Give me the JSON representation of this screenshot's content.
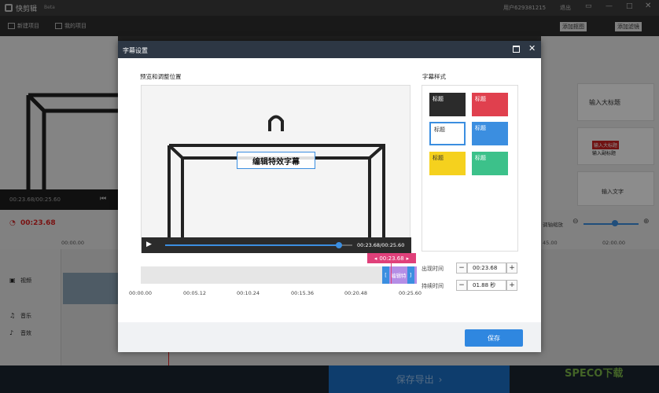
{
  "app": {
    "name": "快剪辑",
    "badge": "Beta",
    "user": "用户629381215",
    "logout": "退出"
  },
  "toolbar": {
    "new_project": "新建项目",
    "my_projects": "我的项目",
    "right_label_1": "添加抠图",
    "right_label_2": "添加滤镜"
  },
  "player": {
    "time": "00:23.68/00:25.60"
  },
  "timeline": {
    "current": "00:23.68",
    "start": "00:00.00",
    "ticks_right": [
      "45.00",
      "02:00.00"
    ],
    "zoom_label": "调轴缩放"
  },
  "tracks": {
    "video": "视频",
    "music": "音乐",
    "sound": "音效"
  },
  "right_panel": {
    "card1": "输入大标题",
    "card2a": "输入大标题",
    "card2b": "输入副标题",
    "card3": "输入文字"
  },
  "export": {
    "label": "保存导出"
  },
  "watermark": {
    "text": "SPECO下载"
  },
  "dialog": {
    "title": "字幕设置",
    "preview_label": "预览和调整位置",
    "subtitle_text": "编辑特效字幕",
    "player_time": "00:23.68/00:25.60",
    "progress": 0.93,
    "style_label": "字幕样式",
    "styles": [
      {
        "label": "标题",
        "bg": "#2b2b2b",
        "fg": "#ffffff"
      },
      {
        "label": "标题",
        "bg": "#e0404e",
        "fg": "#ffffff"
      },
      {
        "label": "标题",
        "bg": "#ffffff",
        "fg": "#333333"
      },
      {
        "label": "标题",
        "bg": "#3b8ee0",
        "fg": "#ffffff"
      },
      {
        "label": "标题",
        "bg": "#f5d11e",
        "fg": "#333333"
      },
      {
        "label": "标题",
        "bg": "#3cc18a",
        "fg": "#ffffff"
      }
    ],
    "cursor_time": "00:23.68",
    "clip_label": "编辑特",
    "ruler": [
      "00:00.00",
      "00:05.12",
      "00:10.24",
      "00:15.36",
      "00:20.48",
      "00:25.60"
    ],
    "appear_label": "出现时间",
    "appear_value": "00:23.68",
    "duration_label": "持续时间",
    "duration_value": "01.88 秒",
    "save": "保存"
  }
}
